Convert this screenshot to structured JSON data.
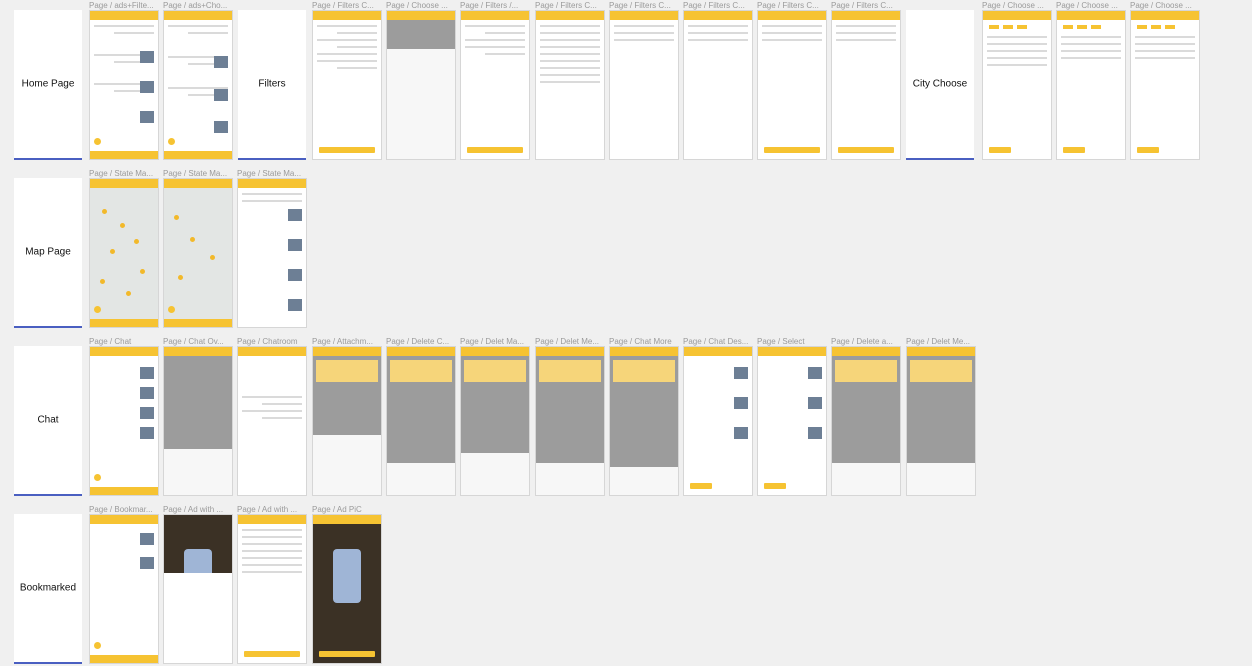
{
  "sections": [
    {
      "label": "Home Page"
    },
    {
      "label": "Filters"
    },
    {
      "label": "City Choose"
    },
    {
      "label": "Map Page"
    },
    {
      "label": "Chat"
    },
    {
      "label": "Bookmarked"
    }
  ],
  "frames": {
    "row1": [
      "Page / ads+Filte...",
      "Page / ads+Cho...",
      "Page / Filters C...",
      "Page / Choose ...",
      "Page / Filters /...",
      "Page / Filters C...",
      "Page / Filters C...",
      "Page / Filters C...",
      "Page / Filters C...",
      "Page / Filters C...",
      "Page / Choose ...",
      "Page / Choose ...",
      "Page / Choose ..."
    ],
    "row2": [
      "Page / State Ma...",
      "Page / State Ma...",
      "Page / State Ma..."
    ],
    "row3": [
      "Page / Chat",
      "Page / Chat Ov...",
      "Page / Chatroom",
      "Page / Attachm...",
      "Page / Delete C...",
      "Page / Delet Ma...",
      "Page / Delet Me...",
      "Page / Chat More",
      "Page / Chat Des...",
      "Page / Select",
      "Page / Delete a...",
      "Page / Delet Me..."
    ],
    "row4": [
      "Page / Bookmar...",
      "Page / Ad with ...",
      "Page / Ad with ...",
      "Page / Ad PiC"
    ]
  },
  "colors": {
    "accent": "#f6c332",
    "section_underline": "#4a5fc1"
  }
}
